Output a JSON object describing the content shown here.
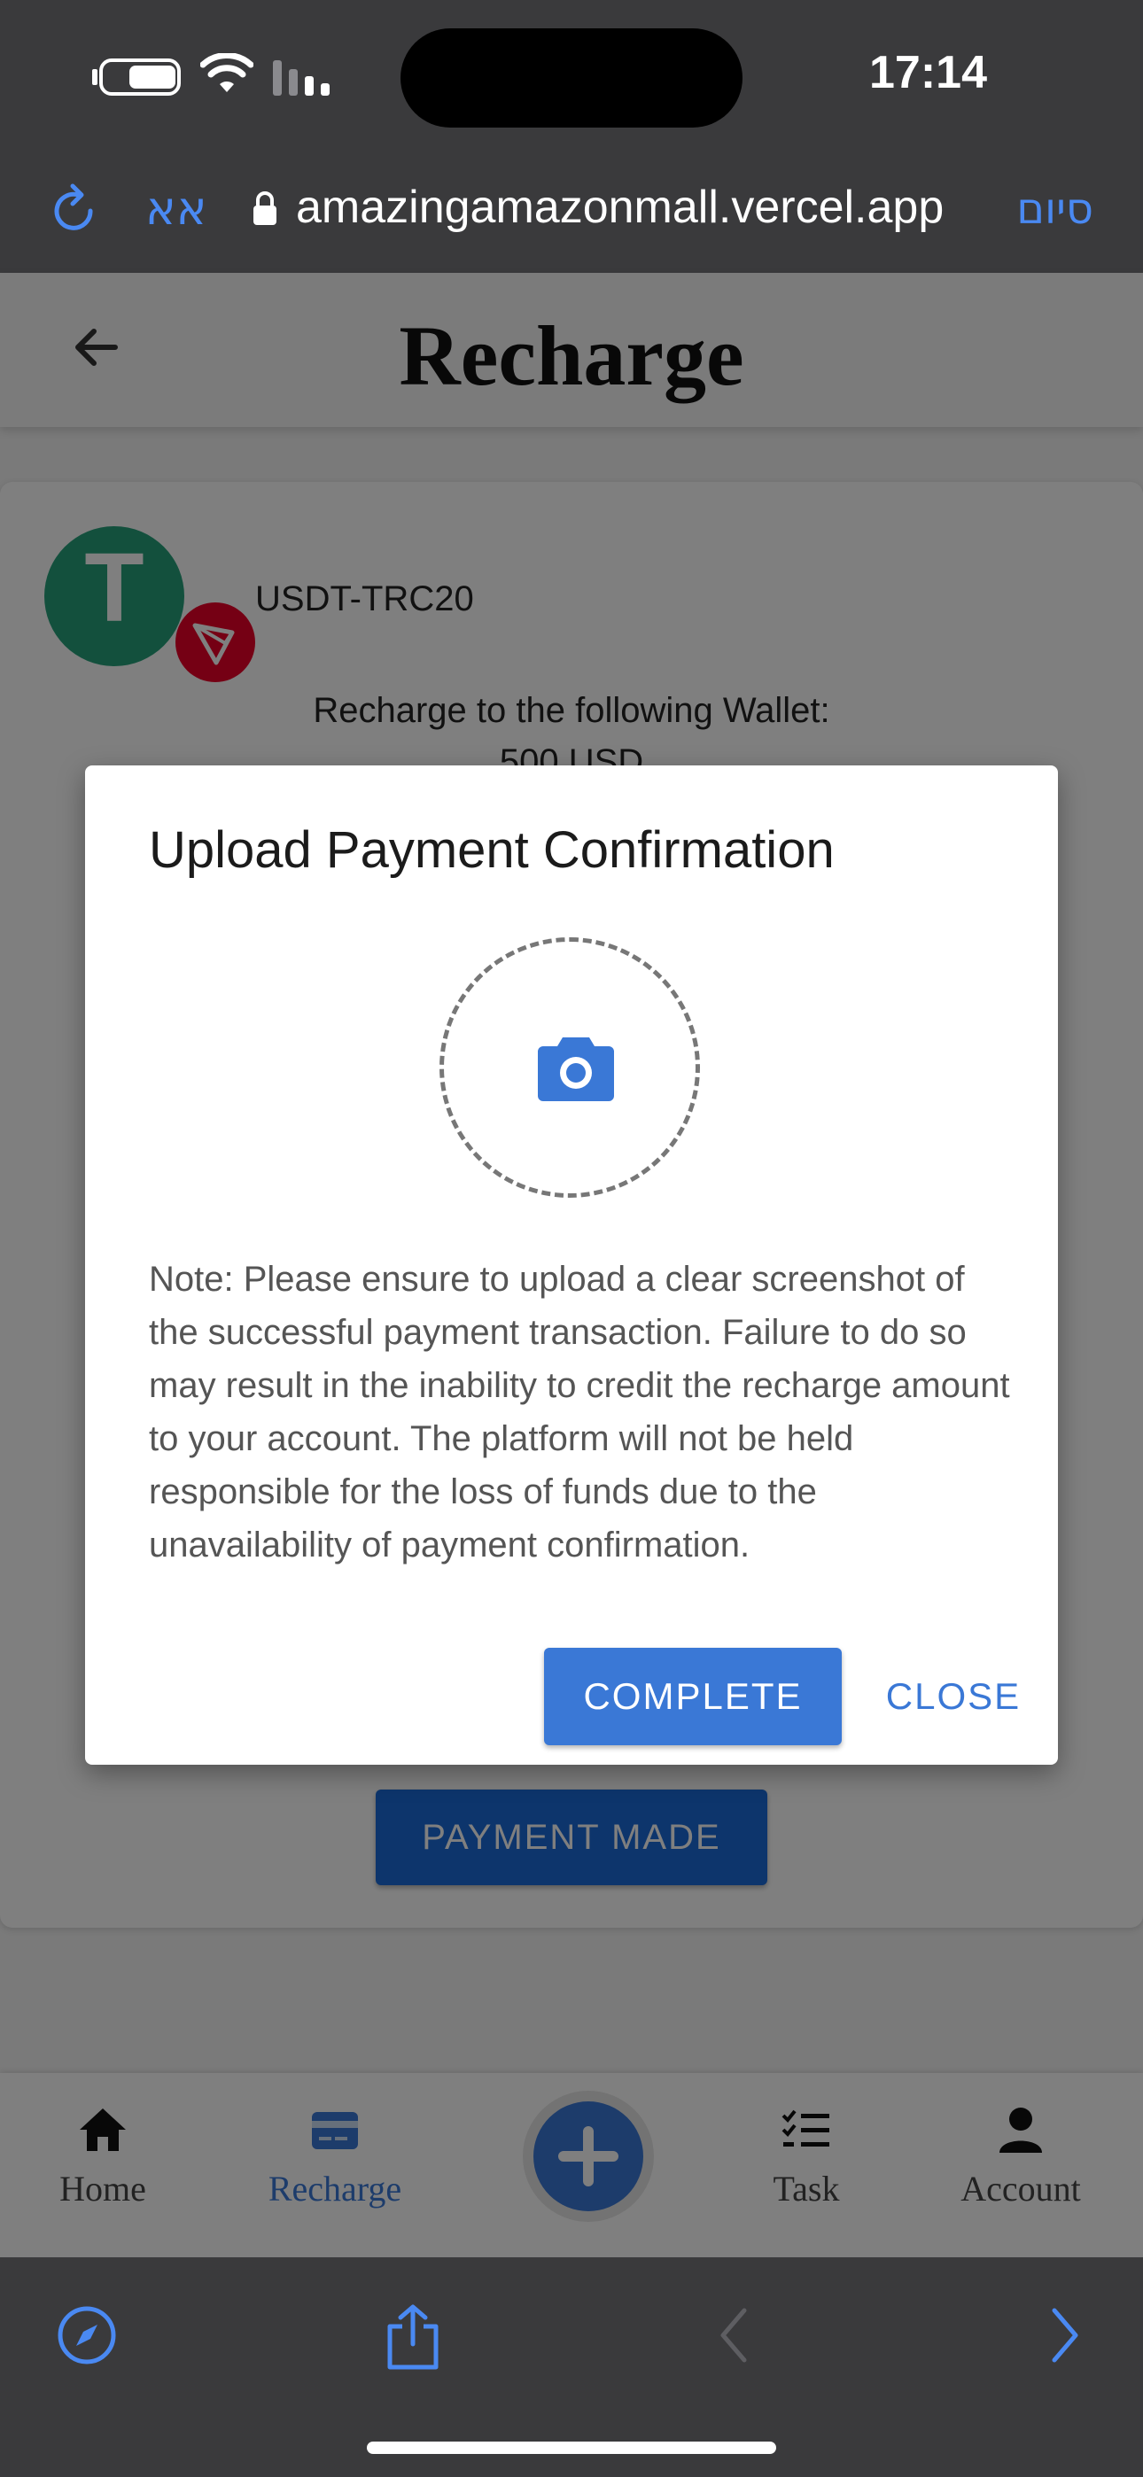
{
  "status_bar": {
    "time": "17:14"
  },
  "browser": {
    "aa_label": "אא",
    "url": "amazingamazonmall.vercel.app",
    "done_label": "סיום"
  },
  "header": {
    "title": "Recharge"
  },
  "recharge_card": {
    "coin_name": "USDT-TRC20",
    "coin_letter": "T",
    "wallet_text": "Recharge to the following Wallet:",
    "amount_text": "500 USD",
    "payment_made_label": "PAYMENT MADE"
  },
  "dialog": {
    "title": "Upload Payment Confirmation",
    "note": "Note: Please ensure to upload a clear screenshot of the successful payment transaction. Failure to do so may result in the inability to credit the recharge amount to your account. The platform will not be held responsible for the loss of funds due to the unavailability of payment confirmation.",
    "complete_label": "COMPLETE",
    "close_label": "CLOSE"
  },
  "bottom_nav": {
    "items": [
      {
        "label": "Home",
        "icon": "home-icon"
      },
      {
        "label": "Recharge",
        "icon": "credit-card-icon",
        "active": true
      },
      {
        "label": "Task",
        "icon": "checklist-icon"
      },
      {
        "label": "Account",
        "icon": "person-icon"
      }
    ]
  },
  "colors": {
    "accent": "#3a78d6",
    "browser_chrome": "#3a3a3c",
    "ios_link": "#4a89f2",
    "usdt_green": "#26a17b",
    "tron_red": "#eb0029"
  }
}
